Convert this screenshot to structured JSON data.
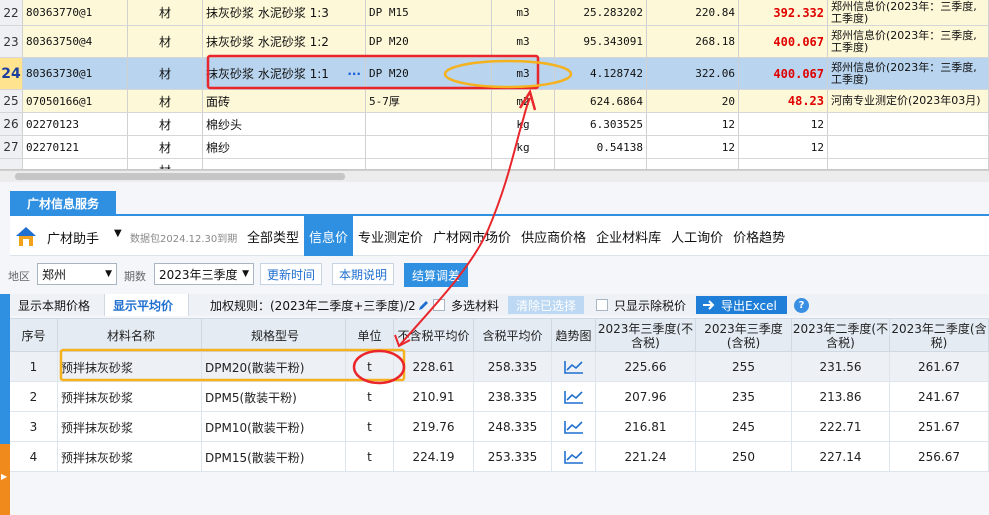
{
  "top_rows": [
    {
      "num": "22",
      "code": "80363770@1",
      "type": "材",
      "name": "抹灰砂浆 水泥砂浆 1:3",
      "spec": "DP M15",
      "unit": "m3",
      "qty": "25.283202",
      "price": "220.84",
      "mprice": "392.332",
      "mprice_red": true,
      "source": "郑州信息价(2023年：三季度,工季度)"
    },
    {
      "num": "23",
      "code": "80363750@4",
      "type": "材",
      "name": "抹灰砂浆 水泥砂浆 1:2",
      "spec": "DP M20",
      "unit": "m3",
      "qty": "95.343091",
      "price": "268.18",
      "mprice": "400.067",
      "mprice_red": true,
      "source": "郑州信息价(2023年：三季度,工季度)"
    },
    {
      "num": "24",
      "code": "80363730@1",
      "type": "材",
      "name": "抹灰砂浆 水泥砂浆 1:1",
      "spec": "DP M20",
      "unit": "m3",
      "qty": "4.128742",
      "price": "322.06",
      "mprice": "400.067",
      "mprice_red": true,
      "source": "郑州信息价(2023年：三季度,工季度)",
      "ellipsis": "···"
    },
    {
      "num": "25",
      "code": "07050166@1",
      "type": "材",
      "name": "面砖",
      "spec": "5-7厚",
      "unit": "m2",
      "qty": "624.6864",
      "price": "20",
      "mprice": "48.23",
      "mprice_red": true,
      "source": "河南专业测定价(2023年03月)"
    },
    {
      "num": "26",
      "code": "02270123",
      "type": "材",
      "name": "棉纱头",
      "spec": "",
      "unit": "kg",
      "qty": "6.303525",
      "price": "12",
      "mprice": "12",
      "mprice_red": false,
      "source": ""
    },
    {
      "num": "27",
      "code": "02270121",
      "type": "材",
      "name": "棉纱",
      "spec": "",
      "unit": "kg",
      "qty": "0.54138",
      "price": "12",
      "mprice": "12",
      "mprice_red": false,
      "source": ""
    },
    {
      "num": "",
      "code": "",
      "type": "材",
      "name": "",
      "spec": "",
      "unit": "",
      "qty": "",
      "price": "",
      "mprice": "",
      "mprice_red": false,
      "source": ""
    }
  ],
  "panel": {
    "tab_label": "广材信息服务",
    "app_name": "广材助手",
    "app_caret": "▼",
    "package_info": "数据包2024.12.30到期",
    "nav": [
      "全部类型",
      "信息价",
      "专业测定价",
      "广材网市场价",
      "供应商价格",
      "企业材料库",
      "人工询价",
      "价格趋势"
    ],
    "nav_active": 1,
    "region_label": "地区",
    "region_value": "郑州",
    "period_label": "期数",
    "period_value": "2023年三季度",
    "update_time_btn": "更新时间",
    "period_desc_btn": "本期说明",
    "settle_btn": "结算调差",
    "show_current_tab": "显示本期价格",
    "show_avg_tab": "显示平均价",
    "weight_rule": "加权规则：(2023年二季度+三季度)/2",
    "multi_select": "多选材料",
    "clear_selected": "清除已选择",
    "only_tax_excl": "只显示除税价",
    "export_excel": "导出Excel",
    "help": "?"
  },
  "table": {
    "headers": [
      "序号",
      "材料名称",
      "规格型号",
      "单位",
      "不含税平均价",
      "含税平均价",
      "趋势图",
      "2023年三季度(不含税)",
      "2023年三季度(含税)",
      "2023年二季度(不含税)",
      "2023年二季度(含税)"
    ],
    "rows": [
      {
        "idx": "1",
        "name": "预拌抹灰砂浆",
        "spec": "DPM20(散装干粉)",
        "unit": "t",
        "avg_ex": "228.61",
        "avg_in": "258.335",
        "q3_ex": "225.66",
        "q3_in": "255",
        "q2_ex": "231.56",
        "q2_in": "261.67"
      },
      {
        "idx": "2",
        "name": "预拌抹灰砂浆",
        "spec": "DPM5(散装干粉)",
        "unit": "t",
        "avg_ex": "210.91",
        "avg_in": "238.335",
        "q3_ex": "207.96",
        "q3_in": "235",
        "q2_ex": "213.86",
        "q2_in": "241.67"
      },
      {
        "idx": "3",
        "name": "预拌抹灰砂浆",
        "spec": "DPM10(散装干粉)",
        "unit": "t",
        "avg_ex": "219.76",
        "avg_in": "248.335",
        "q3_ex": "216.81",
        "q3_in": "245",
        "q2_ex": "222.71",
        "q2_in": "251.67"
      },
      {
        "idx": "4",
        "name": "预拌抹灰砂浆",
        "spec": "DPM15(散装干粉)",
        "unit": "t",
        "avg_ex": "224.19",
        "avg_in": "253.335",
        "q3_ex": "221.24",
        "q3_in": "250",
        "q2_ex": "227.14",
        "q2_in": "256.67"
      }
    ]
  },
  "icons": {
    "trend": "trend-chart-icon",
    "logo": "guangcai-logo-icon",
    "edit": "pencil-icon",
    "export": "arrow-right-icon"
  },
  "colors": {
    "accent": "#2f8fe0",
    "red_value": "#e00000",
    "annotation_red": "#e8262c",
    "annotation_orange": "#f5b21e"
  }
}
